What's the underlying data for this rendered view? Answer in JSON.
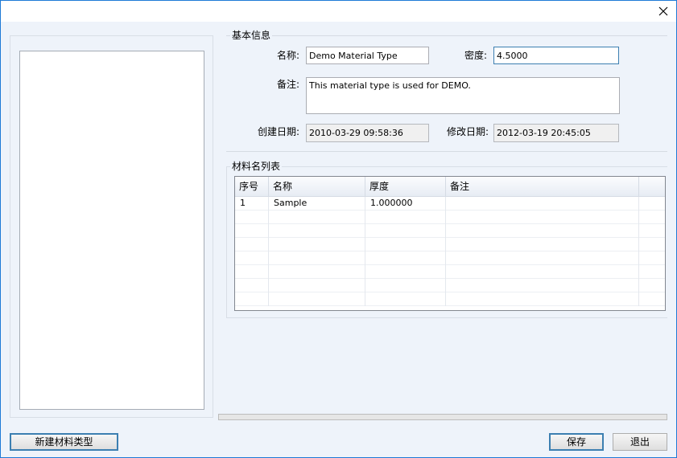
{
  "window": {
    "close_icon": "close-icon"
  },
  "basic_info": {
    "title": "基本信息",
    "name_label": "名称:",
    "name_value": "Demo Material Type",
    "density_label": "密度:",
    "density_value": "4.5000",
    "remark_label": "备注:",
    "remark_value": "This material type is used for DEMO.",
    "created_label": "创建日期:",
    "created_value": "2010-03-29 09:58:36",
    "modified_label": "修改日期:",
    "modified_value": "2012-03-19 20:45:05"
  },
  "material_list": {
    "title": "材料名列表",
    "columns": [
      "序号",
      "名称",
      "厚度",
      "备注"
    ],
    "rows": [
      [
        "1",
        "Sample",
        "1.000000",
        ""
      ]
    ]
  },
  "progress": {
    "value": 0
  },
  "buttons": {
    "new_type": "新建材料类型",
    "save": "保存",
    "exit": "退出"
  },
  "colors": {
    "accent": "#3c7fb1",
    "client_bg": "#eef3fa"
  }
}
